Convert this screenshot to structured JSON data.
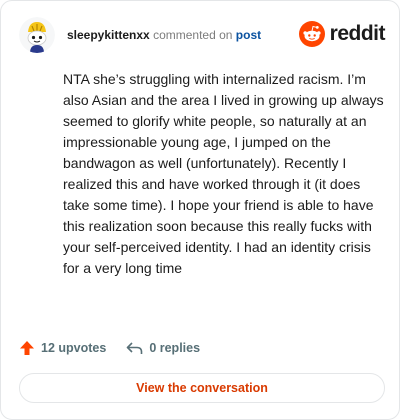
{
  "header": {
    "username": "sleepykittenxx",
    "commented_on_text": "commented on",
    "post_link_text": "post",
    "brand_name": "reddit"
  },
  "comment": {
    "text": "NTA she’s struggling with internalized racism. I’m also Asian and the area I lived in growing up always seemed to glorify white people, so naturally at an impressionable young age, I jumped on the bandwagon as well (unfortunately). Recently I realized this and have worked through it (it does take some time). I hope your friend is able to have this realization soon because this really fucks with your self-perceived identity. I had an identity crisis for a very long time"
  },
  "actions": {
    "upvotes_label": "12 upvotes",
    "replies_label": "0 replies"
  },
  "footer": {
    "view_conversation_label": "View the conversation"
  },
  "colors": {
    "brand_orange": "#ff4500",
    "link_blue": "#0a52a0",
    "upvote_orange": "#ff4500",
    "button_text": "#d93a00"
  },
  "icons": {
    "avatar": "snoo-avatar-yellow-hat",
    "brand": "reddit-snoo-logo",
    "upvote": "upvote-arrow-icon",
    "reply": "reply-arrow-icon"
  }
}
